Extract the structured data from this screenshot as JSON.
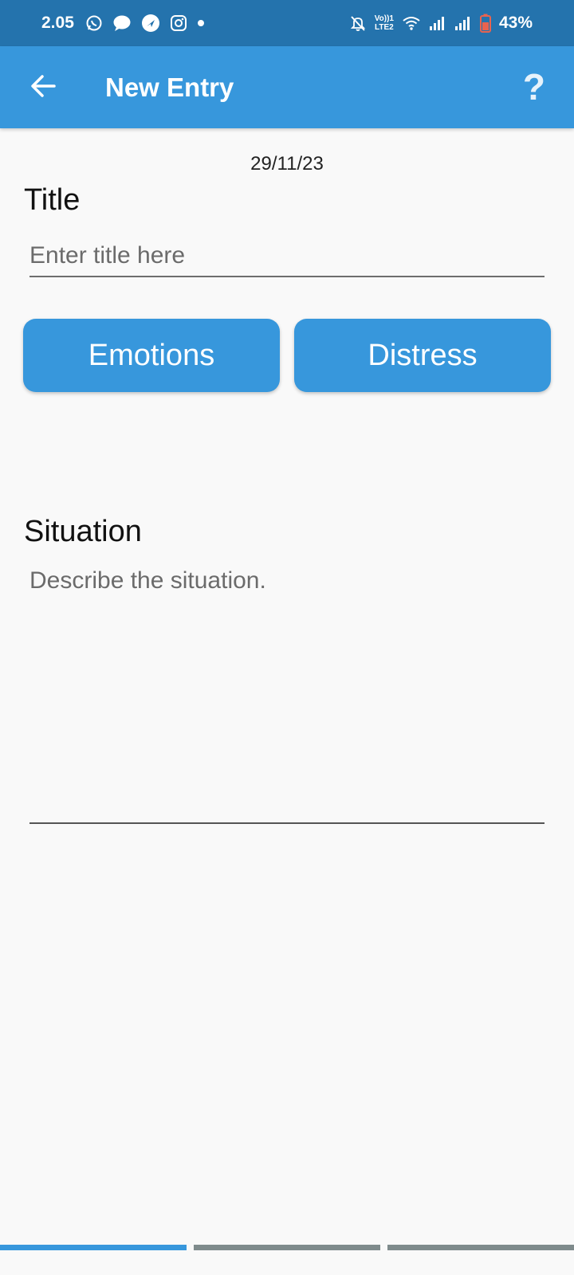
{
  "status_bar": {
    "time": "2.05",
    "left_icons": [
      "whatsapp-icon",
      "message-icon",
      "navigation-icon",
      "instagram-icon",
      "dot-icon"
    ],
    "right_icons": [
      "mute-icon",
      "volte-icon",
      "wifi-icon",
      "signal-icon",
      "signal-icon",
      "battery-icon"
    ],
    "volte_line1": "Vo))1",
    "volte_line2": "LTE2",
    "battery_percent": "43%"
  },
  "app_bar": {
    "back_icon": "arrow-left-icon",
    "title": "New Entry",
    "help_label": "?"
  },
  "entry": {
    "date": "29/11/23",
    "title_label": "Title",
    "title_placeholder": "Enter title here",
    "title_value": "",
    "emotions_label": "Emotions",
    "distress_label": "Distress",
    "situation_label": "Situation",
    "situation_placeholder": "Describe the situation.",
    "situation_value": ""
  },
  "pager": {
    "current_page": 1,
    "total_pages": 3
  },
  "colors": {
    "status_bar": "#2473ad",
    "accent": "#3797dc",
    "background": "#f9f9f9",
    "inactive_indicator": "#7f8b8c",
    "battery_low": "#e8634f"
  }
}
